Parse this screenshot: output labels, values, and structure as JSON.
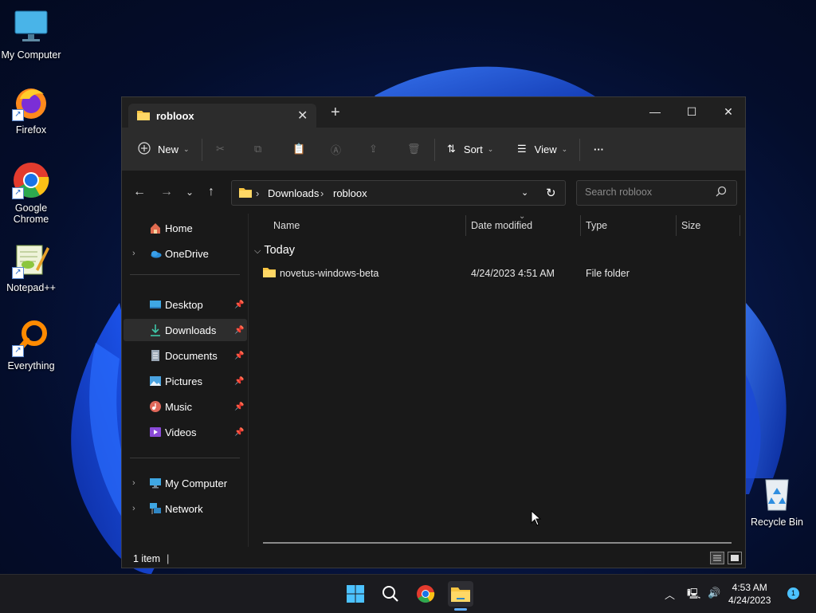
{
  "desktop": {
    "icons": [
      {
        "label": "My Computer",
        "icon": "computer-monitor-icon"
      },
      {
        "label": "Firefox",
        "icon": "firefox-icon"
      },
      {
        "label": "Google\nChrome",
        "icon": "chrome-icon"
      },
      {
        "label": "Notepad++",
        "icon": "notepadpp-icon"
      },
      {
        "label": "Everything",
        "icon": "everything-search-icon"
      },
      {
        "label": "Recycle Bin",
        "icon": "recycle-bin-icon"
      }
    ]
  },
  "window": {
    "tab_title": "robloox",
    "tab_close": "✕",
    "new_tab": "+",
    "controls": {
      "minimize": "—",
      "maximize": "☐",
      "close": "✕"
    },
    "toolbar": {
      "new_label": "New",
      "sort_label": "Sort",
      "view_label": "View",
      "more_label": "···"
    },
    "address": {
      "path": [
        "Downloads",
        "robloox"
      ],
      "search_placeholder": "Search robloox"
    },
    "nav": {
      "home": "Home",
      "onedrive": "OneDrive",
      "quick": [
        {
          "label": "Desktop",
          "icon": "desktop-icon"
        },
        {
          "label": "Downloads",
          "icon": "download-icon",
          "selected": true
        },
        {
          "label": "Documents",
          "icon": "documents-icon"
        },
        {
          "label": "Pictures",
          "icon": "pictures-icon"
        },
        {
          "label": "Music",
          "icon": "music-icon"
        },
        {
          "label": "Videos",
          "icon": "videos-icon"
        }
      ],
      "my_computer": "My Computer",
      "network": "Network"
    },
    "columns": {
      "name": "Name",
      "date": "Date modified",
      "type": "Type",
      "size": "Size"
    },
    "group": {
      "label": "Today",
      "chevron": "⌵"
    },
    "files": [
      {
        "name": "novetus-windows-beta",
        "date": "4/24/2023 4:51 AM",
        "type": "File folder",
        "size": ""
      }
    ],
    "status": {
      "count": "1 item"
    }
  },
  "taskbar": {
    "clock_time": "4:53 AM",
    "clock_date": "4/24/2023",
    "notification_count": "1",
    "accent": "#61aeff"
  }
}
